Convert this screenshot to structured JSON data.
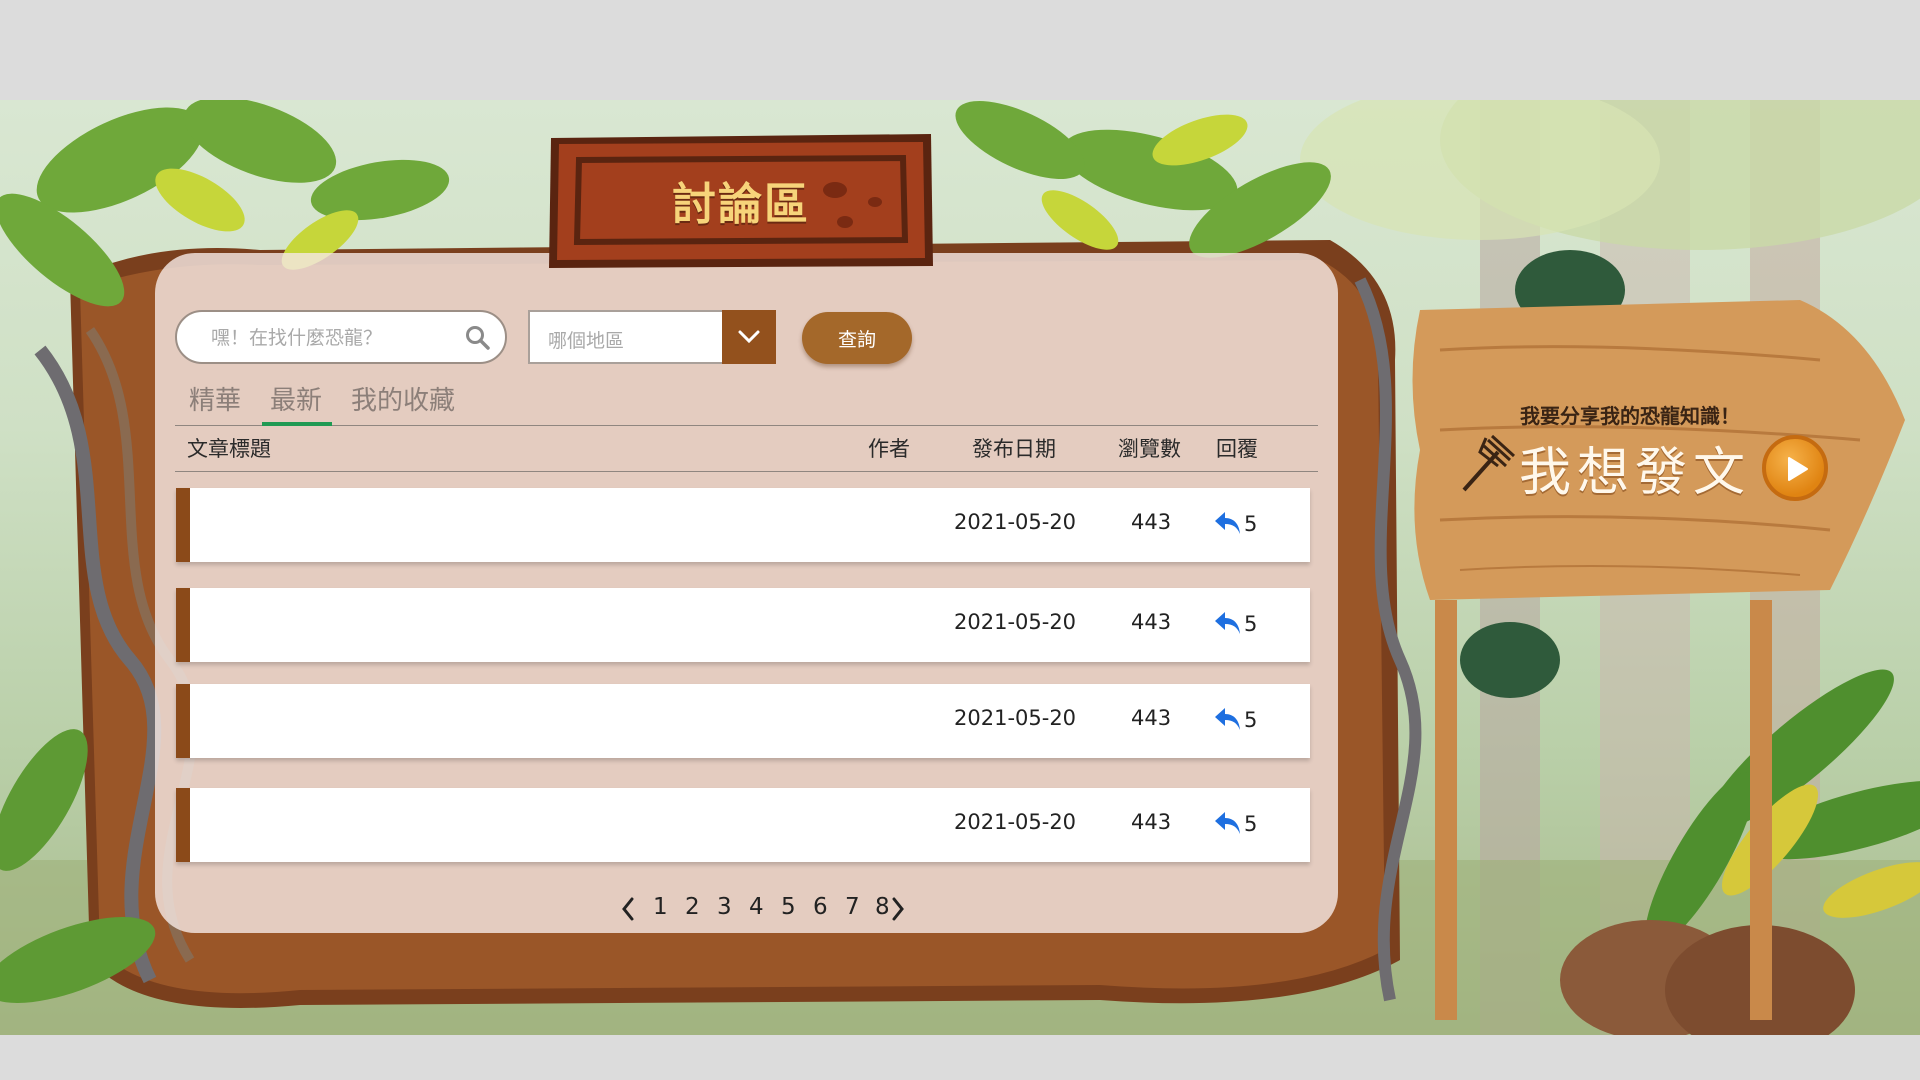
{
  "page": {
    "title": "討論區"
  },
  "search": {
    "placeholder": "嘿！在找什麼恐龍？",
    "region_placeholder": "哪個地區",
    "query_label": "查詢"
  },
  "tabs": [
    {
      "label": "精華",
      "active": false
    },
    {
      "label": "最新",
      "active": true
    },
    {
      "label": "我的收藏",
      "active": false
    }
  ],
  "table": {
    "headers": {
      "title": "文章標題",
      "author": "作者",
      "date": "發布日期",
      "views": "瀏覽數",
      "replies": "回覆"
    },
    "rows": [
      {
        "title": "",
        "author": "",
        "date": "2021-05-20",
        "views": "443",
        "replies": "5"
      },
      {
        "title": "",
        "author": "",
        "date": "2021-05-20",
        "views": "443",
        "replies": "5"
      },
      {
        "title": "",
        "author": "",
        "date": "2021-05-20",
        "views": "443",
        "replies": "5"
      },
      {
        "title": "",
        "author": "",
        "date": "2021-05-20",
        "views": "443",
        "replies": "5"
      }
    ]
  },
  "pagination": {
    "pages": [
      "1",
      "2",
      "3",
      "4",
      "5",
      "6",
      "7",
      "8"
    ]
  },
  "signpost": {
    "subtitle": "我要分享我的恐龍知識！",
    "cta": "我想發文"
  },
  "icons": {
    "search": "search-icon",
    "dropdown": "chevron-down-icon",
    "reply": "reply-icon",
    "prev": "chevron-left-icon",
    "next": "chevron-right-icon",
    "play": "play-icon",
    "fork": "fork-icon"
  },
  "colors": {
    "accent_brown": "#8b4a19",
    "button_brown": "#a4682a",
    "tab_underline": "#1f9a53",
    "reply_blue": "#1e6fe0"
  }
}
